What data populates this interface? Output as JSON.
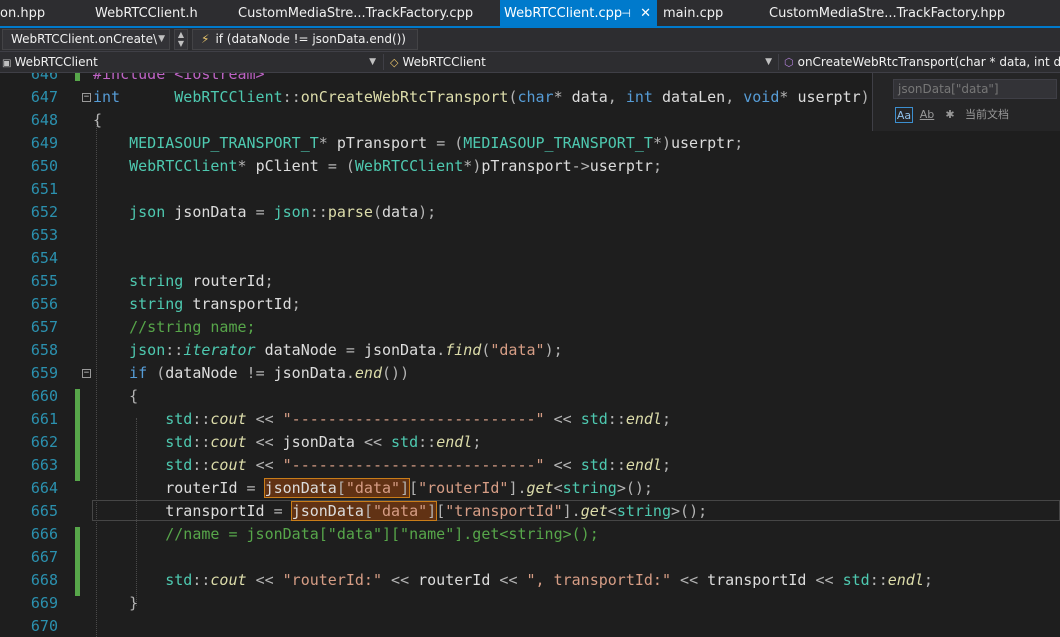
{
  "tabs": [
    {
      "label": "on.hpp"
    },
    {
      "label": "WebRTCClient.h"
    },
    {
      "label": "CustomMediaStre...TrackFactory.cpp"
    },
    {
      "label": "WebRTCClient.cpp",
      "active": true
    },
    {
      "label": "main.cpp"
    },
    {
      "label": "CustomMediaStre...TrackFactory.hpp"
    }
  ],
  "nav": {
    "scope_value": "WebRTCClient.onCreate\\",
    "search_value": "if (dataNode != jsonData.end())"
  },
  "breadcrumbs": {
    "file_scope": "WebRTCClient",
    "class_scope": "WebRTCClient",
    "member_scope": "onCreateWebRtcTransport(char * data, int data"
  },
  "find": {
    "query": "jsonData[\"data\"]",
    "current_doc_label": "当前文档",
    "opt_case": "Aa",
    "opt_word": "Ab"
  },
  "editor": {
    "lines": [
      {
        "n": "646",
        "code": "#include <iostream>"
      },
      {
        "n": "647",
        "code": "int      WebRTCClient::onCreateWebRtcTransport(char* data, int dataLen, void* userptr)"
      },
      {
        "n": "648",
        "code": "{"
      },
      {
        "n": "649",
        "code": "    MEDIASOUP_TRANSPORT_T* pTransport = (MEDIASOUP_TRANSPORT_T*)userptr;"
      },
      {
        "n": "650",
        "code": "    WebRTCClient* pClient = (WebRTCClient*)pTransport->userptr;"
      },
      {
        "n": "651",
        "code": ""
      },
      {
        "n": "652",
        "code": "    json jsonData = json::parse(data);"
      },
      {
        "n": "653",
        "code": ""
      },
      {
        "n": "654",
        "code": ""
      },
      {
        "n": "655",
        "code": "    string routerId;"
      },
      {
        "n": "656",
        "code": "    string transportId;"
      },
      {
        "n": "657",
        "code": "    //string name;"
      },
      {
        "n": "658",
        "code": "    json::iterator dataNode = jsonData.find(\"data\");"
      },
      {
        "n": "659",
        "code": "    if (dataNode != jsonData.end())"
      },
      {
        "n": "660",
        "code": "    {"
      },
      {
        "n": "661",
        "code": "        std::cout << \"---------------------------\" << std::endl;"
      },
      {
        "n": "662",
        "code": "        std::cout << jsonData << std::endl;"
      },
      {
        "n": "663",
        "code": "        std::cout << \"---------------------------\" << std::endl;"
      },
      {
        "n": "664",
        "code": "        routerId = jsonData[\"data\"][\"routerId\"].get<string>();"
      },
      {
        "n": "665",
        "code": "        transportId = jsonData[\"data\"][\"transportId\"].get<string>();"
      },
      {
        "n": "666",
        "code": "        //name = jsonData[\"data\"][\"name\"].get<string>();"
      },
      {
        "n": "667",
        "code": ""
      },
      {
        "n": "668",
        "code": "        std::cout << \"routerId:\" << routerId << \", transportId:\" << transportId << std::endl;"
      },
      {
        "n": "669",
        "code": "    }"
      },
      {
        "n": "670",
        "code": ""
      }
    ]
  },
  "colors": {
    "accent": "#007acc",
    "line_numbers": "#2b91af",
    "keyword": "#569cd6",
    "type": "#4ec9b0",
    "function": "#dcdcaa",
    "string": "#d69d85",
    "comment": "#57a64a",
    "match_highlight": "#613214"
  }
}
